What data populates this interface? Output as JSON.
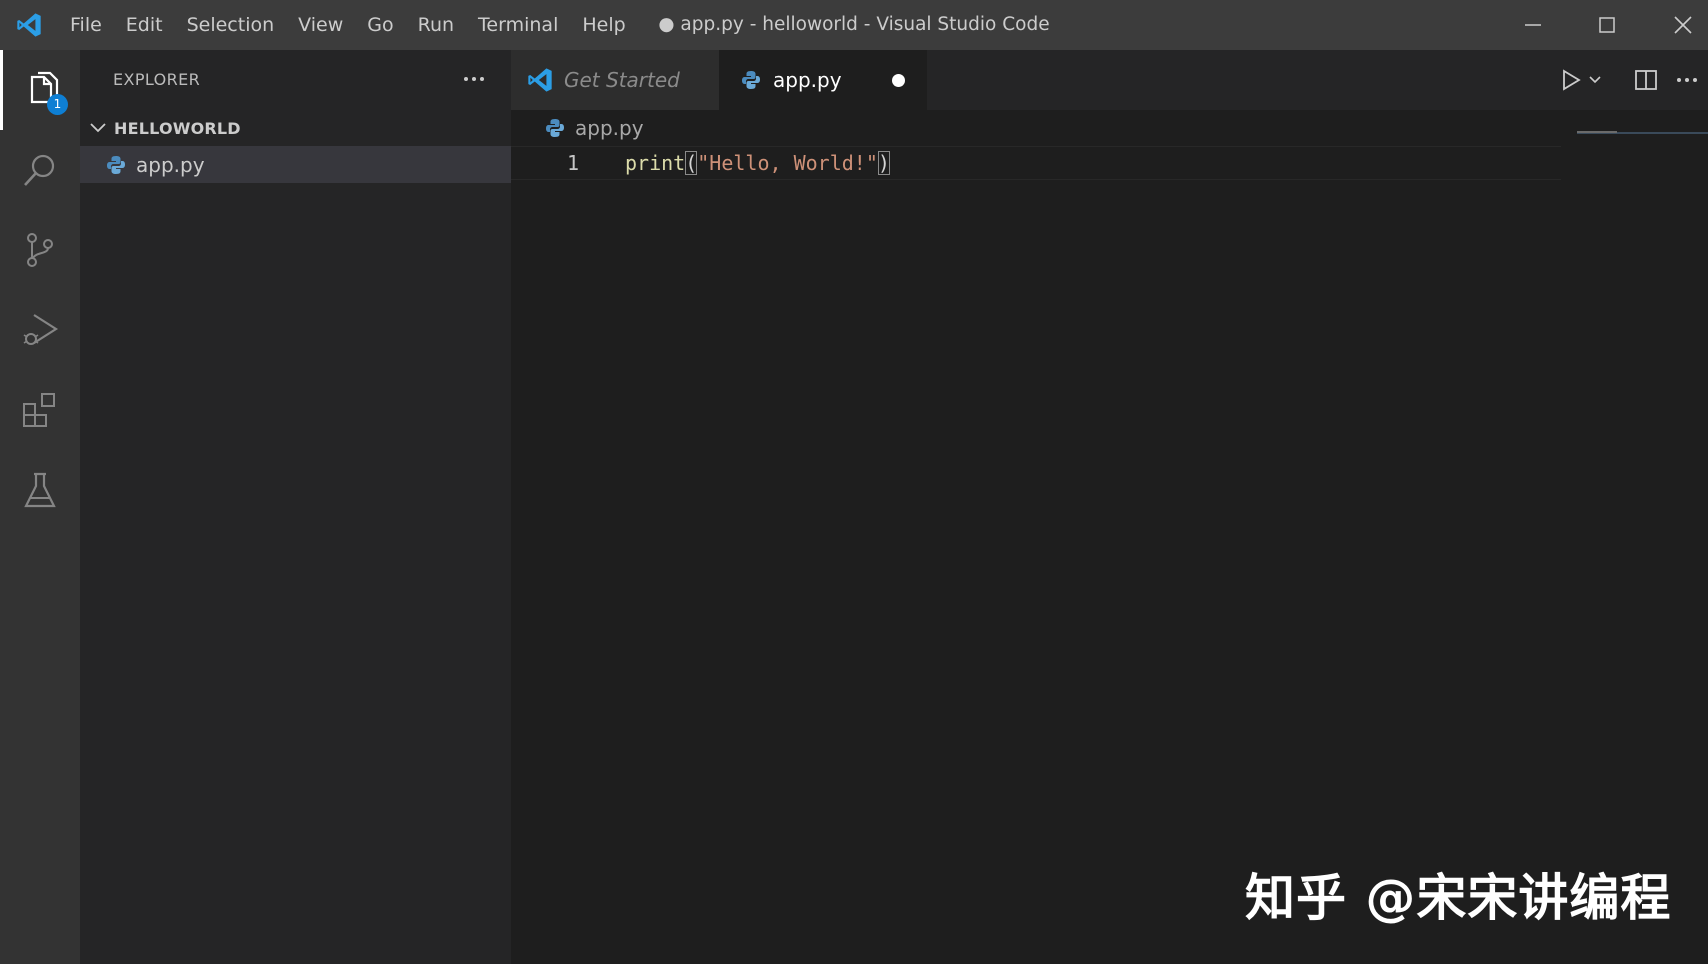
{
  "titlebar": {
    "logo_icon": "vscode-logo-icon",
    "menu": [
      "File",
      "Edit",
      "Selection",
      "View",
      "Go",
      "Run",
      "Terminal",
      "Help"
    ],
    "window_title": "● app.py - helloworld - Visual Studio Code",
    "controls": [
      "minimize-icon",
      "maximize-icon",
      "close-icon"
    ]
  },
  "activitybar": {
    "items": [
      {
        "name": "explorer",
        "icon": "files-icon",
        "badge": "1",
        "active": true
      },
      {
        "name": "search",
        "icon": "search-icon"
      },
      {
        "name": "source-control",
        "icon": "source-control-icon"
      },
      {
        "name": "run-and-debug",
        "icon": "run-debug-icon"
      },
      {
        "name": "extensions",
        "icon": "extensions-icon"
      },
      {
        "name": "testing",
        "icon": "beaker-icon"
      }
    ],
    "accent_color": "#0e7fd4"
  },
  "sidebar": {
    "title": "EXPLORER",
    "folder": "HELLOWORLD",
    "files": [
      "app.py"
    ]
  },
  "editor": {
    "tabs": [
      {
        "label": "Get Started",
        "icon": "vscode-logo-icon"
      },
      {
        "label": "app.py",
        "icon": "python-icon",
        "dirty": true,
        "active": true
      }
    ],
    "breadcrumb": "app.py",
    "lines": [
      {
        "number": "1",
        "tokens": {
          "fn": "print",
          "open": "(",
          "str": "\"Hello, World!\"",
          "close": ")"
        }
      }
    ],
    "toolbar_icons": [
      "run-icon",
      "chevron-down-icon",
      "split-editor-icon",
      "more-icon"
    ]
  },
  "colors": {
    "titlebar": "#3c3c3c",
    "activitybar": "#333333",
    "sidebar": "#252526",
    "editor": "#1e1e1e",
    "string": "#ce9178",
    "function": "#dcdcaa"
  },
  "watermark": "知乎 @宋宋讲编程"
}
